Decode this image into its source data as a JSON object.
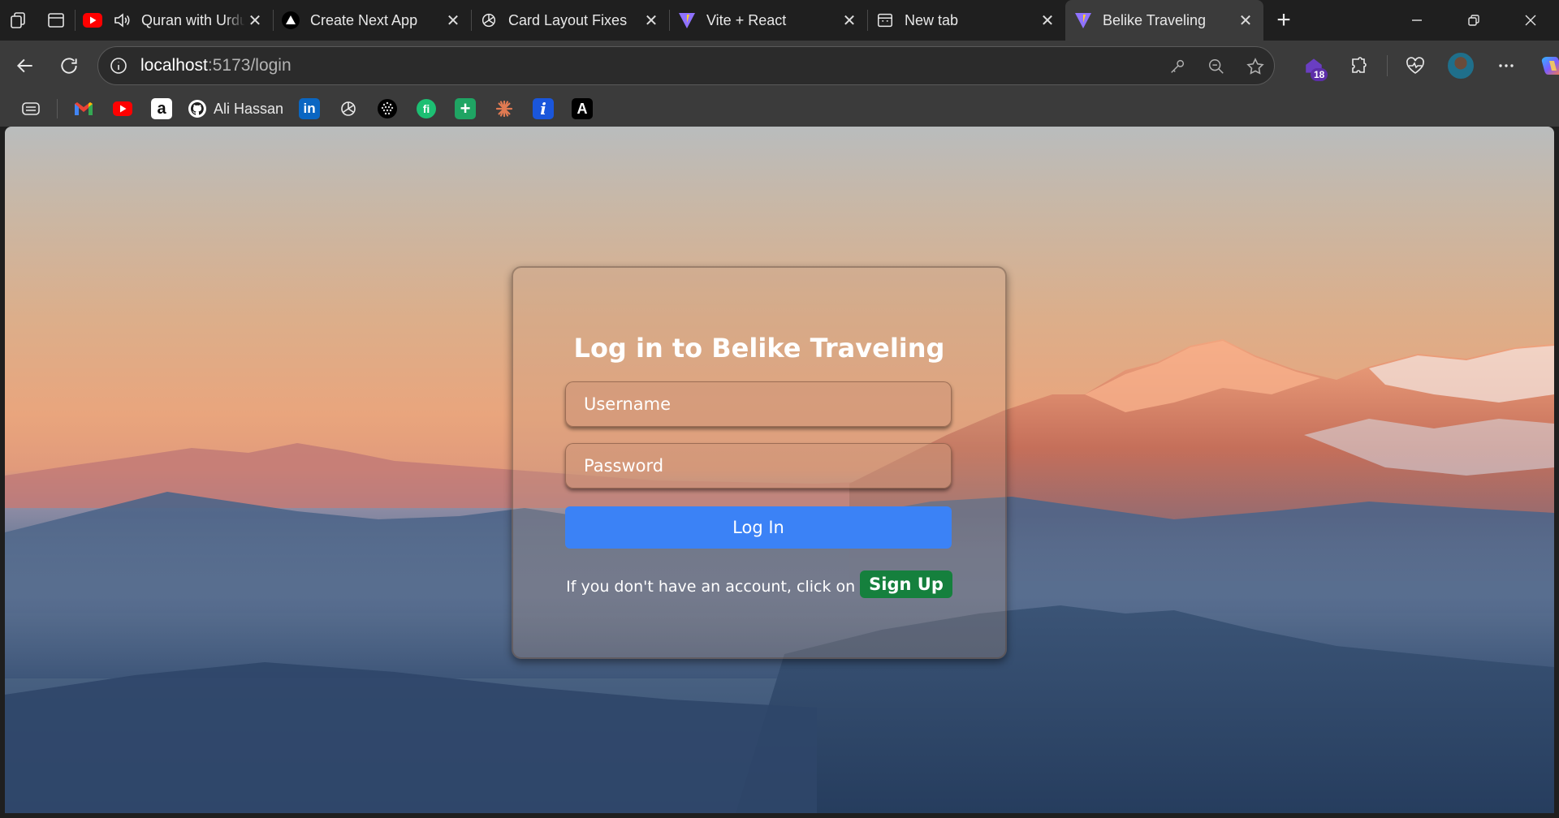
{
  "browser": {
    "tabs": [
      {
        "title": "Quran with Urdu",
        "favicon": "youtube-icon",
        "audio": true
      },
      {
        "title": "Create Next App",
        "favicon": "nextjs-triangle-icon"
      },
      {
        "title": "Card Layout Fixes",
        "favicon": "chatgpt-icon"
      },
      {
        "title": "Vite + React",
        "favicon": "vite-icon"
      },
      {
        "title": "New tab",
        "favicon": "new-tab-page-icon"
      },
      {
        "title": "Belike Traveling",
        "favicon": "vite-icon",
        "active": true
      }
    ],
    "url_host": "localhost",
    "url_rest": ":5173/login",
    "extensions_badge": "18"
  },
  "bookmarks": {
    "items": [
      {
        "icon": "gmail-icon"
      },
      {
        "icon": "youtube-icon"
      },
      {
        "icon": "amazon-icon"
      },
      {
        "icon": "github-icon",
        "label": "Ali Hassan"
      },
      {
        "icon": "linkedin-icon"
      },
      {
        "icon": "chatgpt-icon"
      },
      {
        "icon": "dots-sphere-icon"
      },
      {
        "icon": "fiverr-icon"
      },
      {
        "icon": "green-plus-icon"
      },
      {
        "icon": "claude-asterisk-icon"
      },
      {
        "icon": "info-icon"
      },
      {
        "icon": "letter-a-icon"
      }
    ]
  },
  "login": {
    "title": "Log in to Belike Traveling",
    "username_placeholder": "Username",
    "password_placeholder": "Password",
    "login_button": "Log In",
    "signup_prompt": "If you don't have an account, click on",
    "signup_button": "Sign Up"
  },
  "colors": {
    "login_button": "#3b82f6",
    "signup_button": "#15803d",
    "browser_chrome": "#3b3b3b"
  }
}
